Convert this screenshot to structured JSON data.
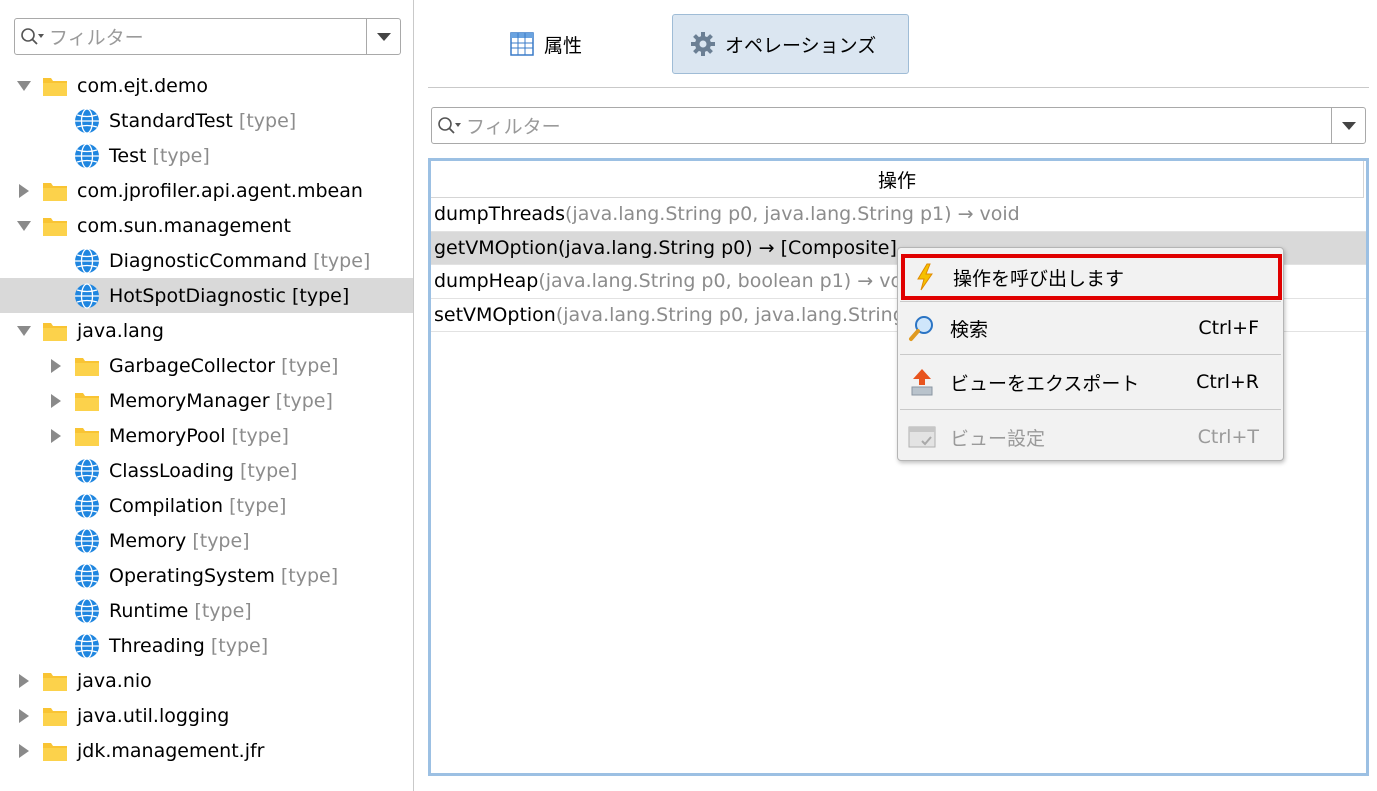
{
  "left_filter": {
    "placeholder": "フィルター"
  },
  "tree": [
    {
      "label": "com.ejt.demo",
      "type": "",
      "kind": "folder",
      "level": 0,
      "expanded": true,
      "selected": false
    },
    {
      "label": "StandardTest",
      "type": "[type]",
      "kind": "bean",
      "level": 1,
      "selected": false
    },
    {
      "label": "Test",
      "type": "[type]",
      "kind": "bean",
      "level": 1,
      "selected": false
    },
    {
      "label": "com.jprofiler.api.agent.mbean",
      "type": "",
      "kind": "folder",
      "level": 0,
      "expanded": false,
      "selected": false
    },
    {
      "label": "com.sun.management",
      "type": "",
      "kind": "folder",
      "level": 0,
      "expanded": true,
      "selected": false
    },
    {
      "label": "DiagnosticCommand",
      "type": "[type]",
      "kind": "bean",
      "level": 1,
      "selected": false
    },
    {
      "label": "HotSpotDiagnostic",
      "type": "[type]",
      "kind": "bean",
      "level": 1,
      "selected": true
    },
    {
      "label": "java.lang",
      "type": "",
      "kind": "folder",
      "level": 0,
      "expanded": true,
      "selected": false
    },
    {
      "label": "GarbageCollector",
      "type": "[type]",
      "kind": "folder",
      "level": 1,
      "expanded": false,
      "selected": false
    },
    {
      "label": "MemoryManager",
      "type": "[type]",
      "kind": "folder",
      "level": 1,
      "expanded": false,
      "selected": false
    },
    {
      "label": "MemoryPool",
      "type": "[type]",
      "kind": "folder",
      "level": 1,
      "expanded": false,
      "selected": false
    },
    {
      "label": "ClassLoading",
      "type": "[type]",
      "kind": "bean",
      "level": 1,
      "selected": false
    },
    {
      "label": "Compilation",
      "type": "[type]",
      "kind": "bean",
      "level": 1,
      "selected": false
    },
    {
      "label": "Memory",
      "type": "[type]",
      "kind": "bean",
      "level": 1,
      "selected": false
    },
    {
      "label": "OperatingSystem",
      "type": "[type]",
      "kind": "bean",
      "level": 1,
      "selected": false
    },
    {
      "label": "Runtime",
      "type": "[type]",
      "kind": "bean",
      "level": 1,
      "selected": false
    },
    {
      "label": "Threading",
      "type": "[type]",
      "kind": "bean",
      "level": 1,
      "selected": false
    },
    {
      "label": "java.nio",
      "type": "",
      "kind": "folder",
      "level": 0,
      "expanded": false,
      "selected": false
    },
    {
      "label": "java.util.logging",
      "type": "",
      "kind": "folder",
      "level": 0,
      "expanded": false,
      "selected": false
    },
    {
      "label": "jdk.management.jfr",
      "type": "",
      "kind": "folder",
      "level": 0,
      "expanded": false,
      "selected": false
    }
  ],
  "tabs": [
    {
      "label": "属性",
      "icon": "table-icon",
      "active": false
    },
    {
      "label": "オペレーションズ",
      "icon": "gear-icon",
      "active": true
    }
  ],
  "ops_filter": {
    "placeholder": "フィルター"
  },
  "table": {
    "header": "操作",
    "rows": [
      {
        "name": "dumpThreads",
        "signature": "(java.lang.String p0, java.lang.String p1) → void",
        "selected": false
      },
      {
        "name": "getVMOption",
        "signature": "(java.lang.String p0) → [Composite]",
        "selected": true
      },
      {
        "name": "dumpHeap",
        "signature": "(java.lang.String p0, boolean p1) → void",
        "selected": false
      },
      {
        "name": "setVMOption",
        "signature": "(java.lang.String p0, java.lang.String p1) → void",
        "selected": false
      }
    ]
  },
  "context_menu": {
    "items": [
      {
        "label": "操作を呼び出します",
        "shortcut": "",
        "icon": "lightning-icon",
        "enabled": true,
        "highlighted": true
      },
      {
        "label": "検索",
        "shortcut": "Ctrl+F",
        "icon": "magnifier-icon",
        "enabled": true,
        "highlighted": false
      },
      {
        "label": "ビューをエクスポート",
        "shortcut": "Ctrl+R",
        "icon": "export-icon",
        "enabled": true,
        "highlighted": false
      },
      {
        "label": "ビュー設定",
        "shortcut": "Ctrl+T",
        "icon": "view-settings-icon",
        "enabled": false,
        "highlighted": false
      }
    ]
  },
  "colors": {
    "selection": "#d9d9d9",
    "table_border": "#9cc0e3",
    "active_tab": "#dbe6f1",
    "menu_highlight": "#e00000",
    "folder": "#f9c433",
    "globe": "#1f86e0"
  }
}
